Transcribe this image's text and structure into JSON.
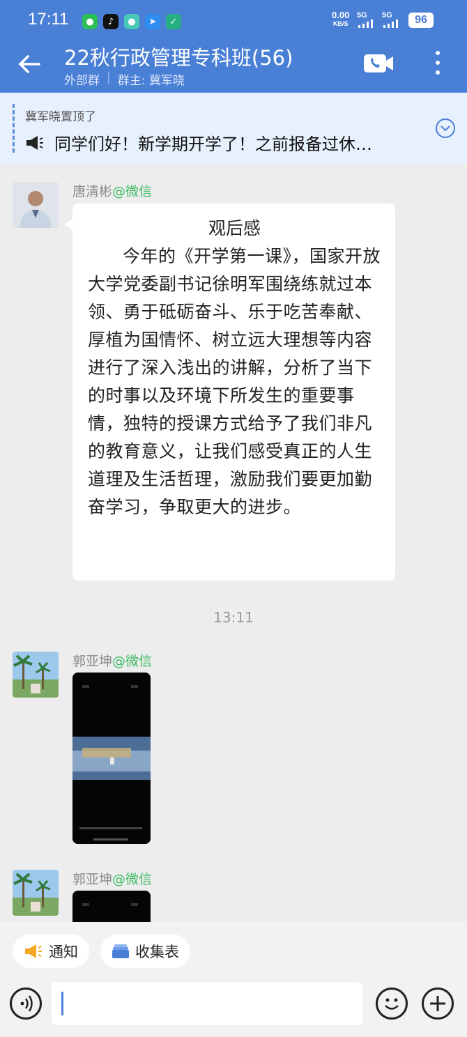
{
  "status_bar": {
    "time": "17:11",
    "net_speed": "0.00",
    "net_unit": "KB/S",
    "sig1": "5G",
    "sig2": "5G",
    "battery": "96"
  },
  "header": {
    "title": "22秋行政管理专科班(56)",
    "tag": "外部群",
    "owner": "群主: 冀军晓"
  },
  "pinned": {
    "by": "冀军晓置顶了",
    "message": "同学们好！新学期开学了！之前报备过休…"
  },
  "messages": [
    {
      "sender": "唐清彬",
      "source": "@微信",
      "title": "观后感",
      "body": "今年的《开学第一课》，国家开放大学党委副书记徐明军围绕练就过本领、勇于砥砺奋斗、乐于吃苦奉献、厚植为国情怀、树立远大理想等内容进行了深入浅出的讲解，分析了当下的时事以及环境下所发生的重要事情，独特的授课方式给予了我们非凡的教育意义，让我们感受真正的人生道理及生活哲理，激励我们要更加勤奋学习，争取更大的进步。"
    },
    {
      "sender": "郭亚坤",
      "source": "@微信"
    },
    {
      "sender": "郭亚坤",
      "source": "@微信"
    }
  ],
  "timestamp": "13:11",
  "toolbar": {
    "notice_label": "通知",
    "form_label": "收集表"
  },
  "icons": {
    "back": "arrow-left-icon",
    "video_call": "video-call-icon",
    "more": "more-vertical-icon",
    "pin_speaker": "megaphone-icon",
    "expand": "chevron-down-circle-icon",
    "voice": "voice-icon",
    "emoji": "emoji-icon",
    "add": "plus-circle-icon"
  },
  "colors": {
    "header_bg": "#4a7fd6",
    "pinned_bg": "#e7f0fd",
    "wechat_green": "#3dbb64"
  }
}
